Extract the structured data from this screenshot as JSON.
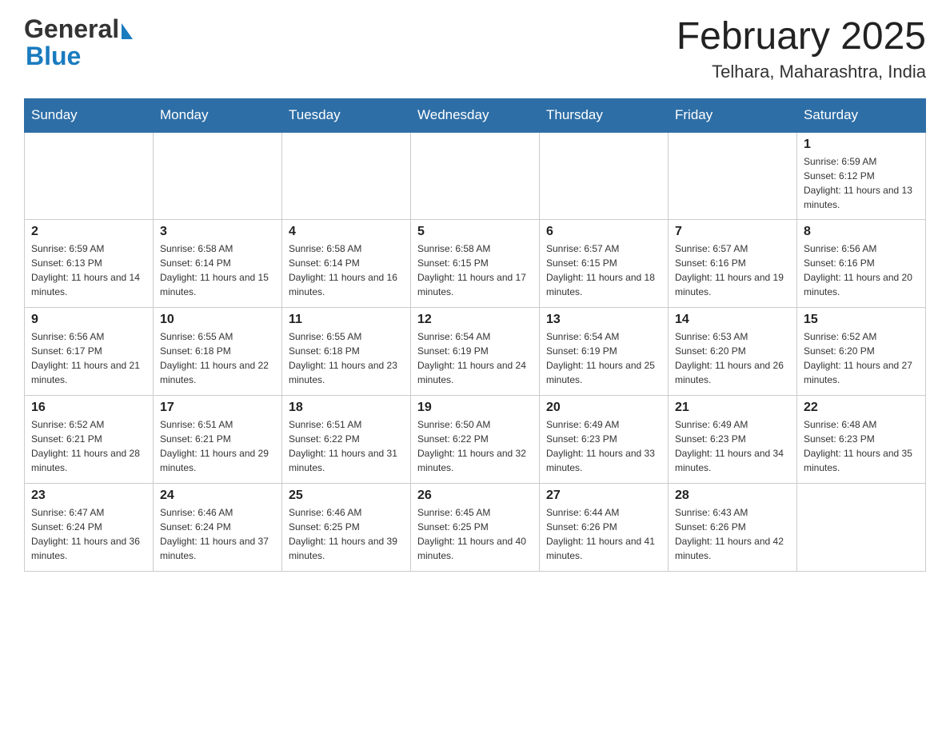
{
  "header": {
    "logo_general": "General",
    "logo_blue": "Blue",
    "month_year": "February 2025",
    "location": "Telhara, Maharashtra, India"
  },
  "days_of_week": [
    "Sunday",
    "Monday",
    "Tuesday",
    "Wednesday",
    "Thursday",
    "Friday",
    "Saturday"
  ],
  "weeks": [
    [
      {
        "day": "",
        "info": ""
      },
      {
        "day": "",
        "info": ""
      },
      {
        "day": "",
        "info": ""
      },
      {
        "day": "",
        "info": ""
      },
      {
        "day": "",
        "info": ""
      },
      {
        "day": "",
        "info": ""
      },
      {
        "day": "1",
        "info": "Sunrise: 6:59 AM\nSunset: 6:12 PM\nDaylight: 11 hours and 13 minutes."
      }
    ],
    [
      {
        "day": "2",
        "info": "Sunrise: 6:59 AM\nSunset: 6:13 PM\nDaylight: 11 hours and 14 minutes."
      },
      {
        "day": "3",
        "info": "Sunrise: 6:58 AM\nSunset: 6:14 PM\nDaylight: 11 hours and 15 minutes."
      },
      {
        "day": "4",
        "info": "Sunrise: 6:58 AM\nSunset: 6:14 PM\nDaylight: 11 hours and 16 minutes."
      },
      {
        "day": "5",
        "info": "Sunrise: 6:58 AM\nSunset: 6:15 PM\nDaylight: 11 hours and 17 minutes."
      },
      {
        "day": "6",
        "info": "Sunrise: 6:57 AM\nSunset: 6:15 PM\nDaylight: 11 hours and 18 minutes."
      },
      {
        "day": "7",
        "info": "Sunrise: 6:57 AM\nSunset: 6:16 PM\nDaylight: 11 hours and 19 minutes."
      },
      {
        "day": "8",
        "info": "Sunrise: 6:56 AM\nSunset: 6:16 PM\nDaylight: 11 hours and 20 minutes."
      }
    ],
    [
      {
        "day": "9",
        "info": "Sunrise: 6:56 AM\nSunset: 6:17 PM\nDaylight: 11 hours and 21 minutes."
      },
      {
        "day": "10",
        "info": "Sunrise: 6:55 AM\nSunset: 6:18 PM\nDaylight: 11 hours and 22 minutes."
      },
      {
        "day": "11",
        "info": "Sunrise: 6:55 AM\nSunset: 6:18 PM\nDaylight: 11 hours and 23 minutes."
      },
      {
        "day": "12",
        "info": "Sunrise: 6:54 AM\nSunset: 6:19 PM\nDaylight: 11 hours and 24 minutes."
      },
      {
        "day": "13",
        "info": "Sunrise: 6:54 AM\nSunset: 6:19 PM\nDaylight: 11 hours and 25 minutes."
      },
      {
        "day": "14",
        "info": "Sunrise: 6:53 AM\nSunset: 6:20 PM\nDaylight: 11 hours and 26 minutes."
      },
      {
        "day": "15",
        "info": "Sunrise: 6:52 AM\nSunset: 6:20 PM\nDaylight: 11 hours and 27 minutes."
      }
    ],
    [
      {
        "day": "16",
        "info": "Sunrise: 6:52 AM\nSunset: 6:21 PM\nDaylight: 11 hours and 28 minutes."
      },
      {
        "day": "17",
        "info": "Sunrise: 6:51 AM\nSunset: 6:21 PM\nDaylight: 11 hours and 29 minutes."
      },
      {
        "day": "18",
        "info": "Sunrise: 6:51 AM\nSunset: 6:22 PM\nDaylight: 11 hours and 31 minutes."
      },
      {
        "day": "19",
        "info": "Sunrise: 6:50 AM\nSunset: 6:22 PM\nDaylight: 11 hours and 32 minutes."
      },
      {
        "day": "20",
        "info": "Sunrise: 6:49 AM\nSunset: 6:23 PM\nDaylight: 11 hours and 33 minutes."
      },
      {
        "day": "21",
        "info": "Sunrise: 6:49 AM\nSunset: 6:23 PM\nDaylight: 11 hours and 34 minutes."
      },
      {
        "day": "22",
        "info": "Sunrise: 6:48 AM\nSunset: 6:23 PM\nDaylight: 11 hours and 35 minutes."
      }
    ],
    [
      {
        "day": "23",
        "info": "Sunrise: 6:47 AM\nSunset: 6:24 PM\nDaylight: 11 hours and 36 minutes."
      },
      {
        "day": "24",
        "info": "Sunrise: 6:46 AM\nSunset: 6:24 PM\nDaylight: 11 hours and 37 minutes."
      },
      {
        "day": "25",
        "info": "Sunrise: 6:46 AM\nSunset: 6:25 PM\nDaylight: 11 hours and 39 minutes."
      },
      {
        "day": "26",
        "info": "Sunrise: 6:45 AM\nSunset: 6:25 PM\nDaylight: 11 hours and 40 minutes."
      },
      {
        "day": "27",
        "info": "Sunrise: 6:44 AM\nSunset: 6:26 PM\nDaylight: 11 hours and 41 minutes."
      },
      {
        "day": "28",
        "info": "Sunrise: 6:43 AM\nSunset: 6:26 PM\nDaylight: 11 hours and 42 minutes."
      },
      {
        "day": "",
        "info": ""
      }
    ]
  ]
}
